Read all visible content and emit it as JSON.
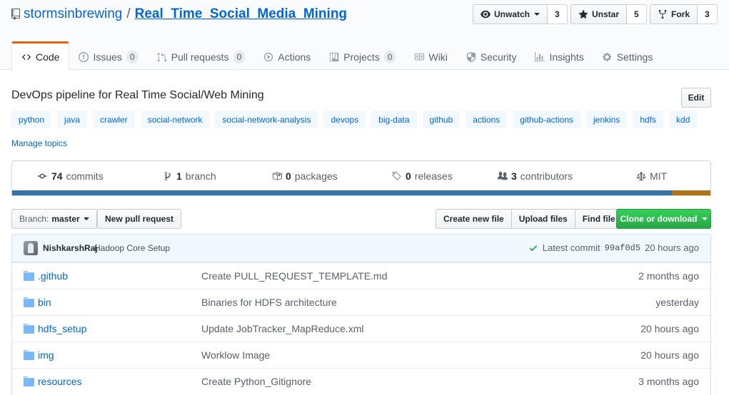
{
  "repo": {
    "owner": "stormsinbrewing",
    "separator": "/",
    "name": "Real_Time_Social_Media_Mining"
  },
  "social": {
    "watch_label": "Unwatch",
    "watch_count": "3",
    "star_label": "Unstar",
    "star_count": "5",
    "fork_label": "Fork",
    "fork_count": "3"
  },
  "tabs": [
    {
      "label": "Code",
      "icon": "code-icon"
    },
    {
      "label": "Issues",
      "counter": "0",
      "icon": "issue-icon"
    },
    {
      "label": "Pull requests",
      "counter": "0",
      "icon": "pull-request-icon"
    },
    {
      "label": "Actions",
      "icon": "play-icon"
    },
    {
      "label": "Projects",
      "counter": "0",
      "icon": "project-icon"
    },
    {
      "label": "Wiki",
      "icon": "book-icon"
    },
    {
      "label": "Security",
      "icon": "shield-icon"
    },
    {
      "label": "Insights",
      "icon": "graph-icon"
    },
    {
      "label": "Settings",
      "icon": "gear-icon"
    }
  ],
  "description": "DevOps pipeline for Real Time Social/Web Mining",
  "edit_label": "Edit",
  "topics": [
    "python",
    "java",
    "crawler",
    "social-network",
    "social-network-analysis",
    "devops",
    "big-data",
    "github",
    "actions",
    "github-actions",
    "jenkins",
    "hdfs",
    "kdd"
  ],
  "manage_topics": "Manage topics",
  "summary": {
    "commits_num": "74",
    "commits_label": "commits",
    "branch_num": "1",
    "branch_label": "branch",
    "packages_num": "0",
    "packages_label": "packages",
    "releases_num": "0",
    "releases_label": "releases",
    "contributors_num": "3",
    "contributors_label": "contributors",
    "license": "MIT"
  },
  "language_bar": [
    {
      "color": "#3572a5",
      "percent": 94.5
    },
    {
      "color": "#b07219",
      "percent": 5.5
    }
  ],
  "file_nav": {
    "branch_label": "Branch:",
    "branch_value": "master",
    "new_pr": "New pull request",
    "create_file": "Create new file",
    "upload_files": "Upload files",
    "find_file": "Find file",
    "clone": "Clone or download"
  },
  "commit": {
    "author": "NishkarshRaj",
    "message": "Hadoop Core Setup",
    "latest_label": "Latest commit",
    "sha": "99af0d5",
    "age": "20 hours ago"
  },
  "files": [
    {
      "name": ".github",
      "message": "Create PULL_REQUEST_TEMPLATE.md",
      "age": "2 months ago"
    },
    {
      "name": "bin",
      "message": "Binaries for HDFS architecture",
      "age": "yesterday"
    },
    {
      "name": "hdfs_setup",
      "message": "Update JobTracker_MapReduce.xml",
      "age": "20 hours ago"
    },
    {
      "name": "img",
      "message": "Worklow Image",
      "age": "20 hours ago"
    },
    {
      "name": "resources",
      "message": "Create Python_Gitignore",
      "age": "3 months ago"
    }
  ]
}
